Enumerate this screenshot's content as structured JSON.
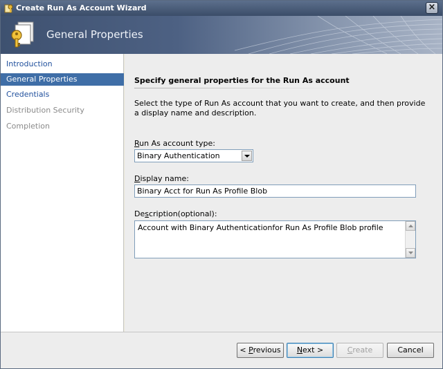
{
  "window": {
    "title": "Create Run As Account Wizard",
    "header_title": "General Properties"
  },
  "nav": {
    "items": [
      {
        "label": "Introduction",
        "state": "link"
      },
      {
        "label": "General Properties",
        "state": "selected"
      },
      {
        "label": "Credentials",
        "state": "link"
      },
      {
        "label": "Distribution Security",
        "state": "disabled"
      },
      {
        "label": "Completion",
        "state": "disabled"
      }
    ]
  },
  "main": {
    "heading": "Specify general properties for the Run As account",
    "intro": "Select the type of Run As account that you want to create, and then provide a display name and description.",
    "account_type": {
      "label_prefix": "R",
      "label_rest": "un As account type:",
      "selected": "Binary Authentication"
    },
    "display_name": {
      "label_prefix": "D",
      "label_rest": "isplay name:",
      "value": "Binary Acct for Run As Profile Blob"
    },
    "description": {
      "label_prefix": "De",
      "label_underlined": "s",
      "label_rest": "cription(optional):",
      "value": "Account with Binary Authenticationfor Run As Profile Blob profile"
    }
  },
  "footer": {
    "previous_u": "P",
    "previous_rest": "revious",
    "previous_prefix": "< ",
    "next_u": "N",
    "next_rest": "ext >",
    "create_u": "C",
    "create_rest": "reate",
    "cancel": "Cancel"
  },
  "colors": {
    "nav_selected": "#3f6ea7",
    "nav_link": "#1f4f9c",
    "nav_disabled": "#8a8a8a"
  }
}
